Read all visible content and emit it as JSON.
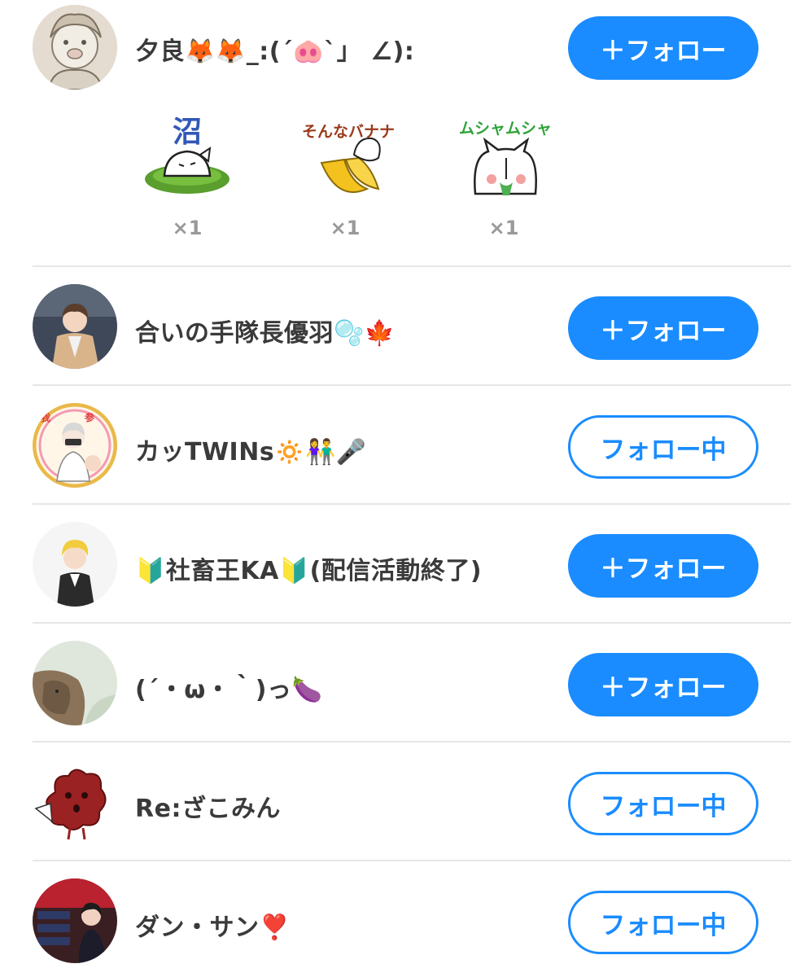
{
  "users": [
    {
      "name": "夕良🦊🦊_:(´🐽`」 ∠):",
      "button": "＋フォロー",
      "state": "follow"
    },
    {
      "name": "合いの手隊長優羽🫧🍁",
      "button": "＋フォロー",
      "state": "follow"
    },
    {
      "name": "カッTWINs🔅👫🎤",
      "button": "フォロー中",
      "state": "following"
    },
    {
      "name": "🔰社畜王KA🔰(配信活動終了)",
      "button": "＋フォロー",
      "state": "follow"
    },
    {
      "name": "(´・ω・｀)っ🍆",
      "button": "＋フォロー",
      "state": "follow"
    },
    {
      "name": "Re:ざこみん",
      "button": "フォロー中",
      "state": "following"
    },
    {
      "name": "ダン・サン❣️",
      "button": "フォロー中",
      "state": "following"
    }
  ],
  "stamps": [
    {
      "name": "swamp-stamp",
      "text": "沼",
      "count": "×1"
    },
    {
      "name": "banana-stamp",
      "text": "そんなバナナ",
      "count": "×1"
    },
    {
      "name": "munching-stamp",
      "text": "ムシャムシャ",
      "count": "×1"
    }
  ]
}
